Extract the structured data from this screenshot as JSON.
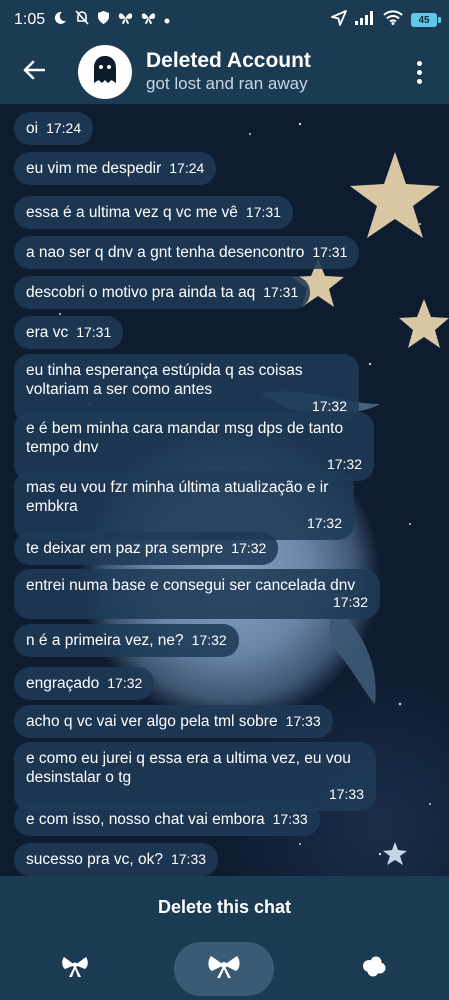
{
  "status_bar": {
    "time": "1:05",
    "battery": "45",
    "icons": [
      "moon-icon",
      "bell-off-icon",
      "shield-icon",
      "butterfly-icon",
      "butterfly-icon",
      "dot-icon",
      "location-icon",
      "signal-icon",
      "wifi-icon",
      "battery-icon"
    ]
  },
  "header": {
    "title": "Deleted Account",
    "subtitle": "got lost and ran away",
    "back_icon": "arrow-left-icon",
    "avatar_icon": "ghost-icon",
    "menu_icon": "more-vertical-icon"
  },
  "messages": [
    {
      "text": "oi",
      "time": "17:24"
    },
    {
      "text": "eu vim me despedir",
      "time": "17:24"
    },
    {
      "text": "essa é a ultima vez q vc me vê",
      "time": "17:31"
    },
    {
      "text": "a nao ser q dnv a gnt tenha desencontro",
      "time": "17:31"
    },
    {
      "text": "descobri o motivo pra ainda ta aq",
      "time": "17:31"
    },
    {
      "text": "era vc",
      "time": "17:31"
    },
    {
      "text": "eu tinha esperança estúpida q as coisas\nvoltariam a ser como antes",
      "time": "17:32"
    },
    {
      "text": "e é bem minha cara mandar msg dps de tanto\ntempo dnv",
      "time": "17:32"
    },
    {
      "text": "mas eu vou fzr minha última atualização e ir\nembkra",
      "time": "17:32"
    },
    {
      "text": "te deixar em paz pra sempre",
      "time": "17:32"
    },
    {
      "text": "entrei numa base e consegui ser cancelada dnv",
      "time": "17:32"
    },
    {
      "text": "n é a primeira vez, ne?",
      "time": "17:32"
    },
    {
      "text": "engraçado",
      "time": "17:32"
    },
    {
      "text": "acho q vc vai ver algo pela tml sobre",
      "time": "17:33"
    },
    {
      "text": "e como eu jurei q essa era a ultima vez, eu vou\ndesinstalar o tg",
      "time": "17:33"
    },
    {
      "text": "e com isso, nosso chat vai embora",
      "time": "17:33"
    },
    {
      "text": "sucesso pra vc, ok?",
      "time": "17:33"
    }
  ],
  "bottom": {
    "delete_label": "Delete this chat"
  },
  "nav": {
    "icons": [
      "bow-icon",
      "bow-icon",
      "cloud-icon"
    ]
  },
  "colors": {
    "bar_bg": "#1b3b53",
    "bubble_bg": "#1f3a56",
    "accent": "#5ec8e6"
  }
}
